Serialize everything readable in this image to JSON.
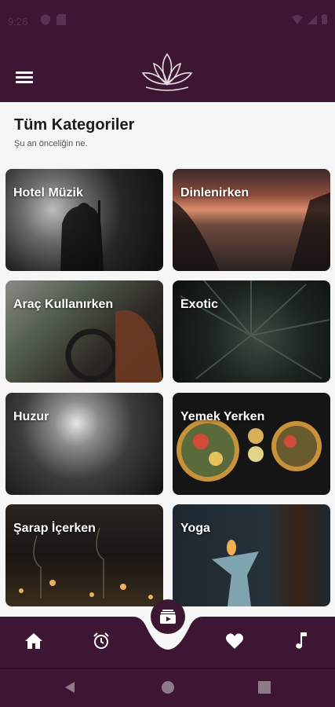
{
  "status_bar": {
    "time": "9:26"
  },
  "header": {
    "menu_icon": "hamburger-icon",
    "logo_icon": "lotus-logo-icon"
  },
  "page": {
    "title": "Tüm Kategoriler",
    "subtitle": "Şu an önceliğin ne."
  },
  "categories": [
    {
      "label": "Hotel Müzik"
    },
    {
      "label": "Dinlenirken"
    },
    {
      "label": "Araç Kullanırken"
    },
    {
      "label": "Exotic"
    },
    {
      "label": "Huzur"
    },
    {
      "label": "Yemek Yerken"
    },
    {
      "label": "Şarap İçerken"
    },
    {
      "label": "Yoga"
    }
  ],
  "bottom_nav": {
    "items": [
      "home-icon",
      "alarm-clock-icon",
      "playlist-icon",
      "heart-icon",
      "music-note-icon"
    ]
  },
  "colors": {
    "primary": "#3d1633",
    "background": "#f7f6f7"
  }
}
